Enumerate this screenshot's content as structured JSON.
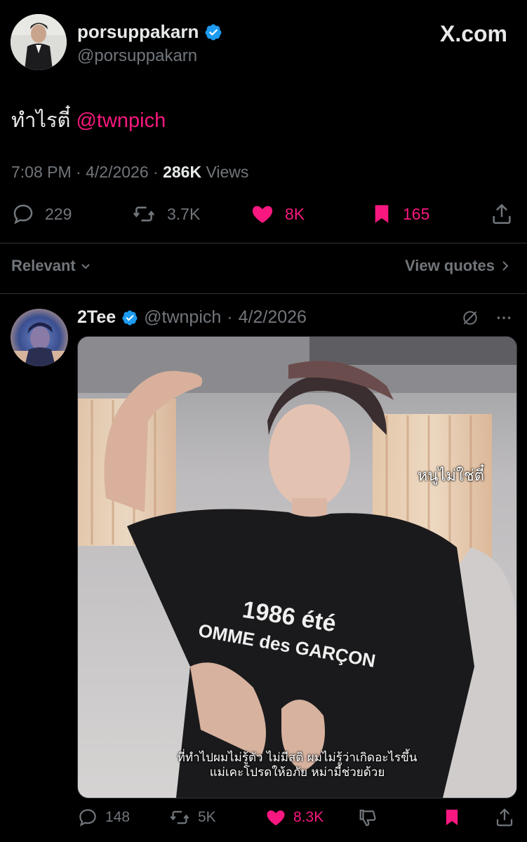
{
  "tweet": {
    "display_name": "porsuppakarn",
    "handle": "@porsuppakarn",
    "brand": "X.com",
    "text": "ทำไรตี๋",
    "mention": "@twnpich",
    "time": "7:08 PM",
    "date": "4/2/2026",
    "views_count": "286K",
    "views_label": "Views",
    "replies": "229",
    "reposts": "3.7K",
    "likes": "8K",
    "bookmarks": "165"
  },
  "sort": {
    "label": "Relevant",
    "view_quotes": "View quotes"
  },
  "reply": {
    "display_name": "2Tee",
    "handle": "@twnpich",
    "date": "4/2/2026",
    "media_caption_top": "หนูไม่ใช่ตี๋",
    "media_caption_line1": "ที่ทำไปผมไม่รู้ตัว ไม่มีสติ ผมไม่รู้ว่าเกิดอะไรขึ้น",
    "media_caption_line2": "แม่เคะโปรดให้อภัย หม่ามี้ช่วยด้วย",
    "shirt_line1": "1986 été",
    "shirt_line2": "OMME des GARÇON",
    "replies": "148",
    "reposts": "5K",
    "likes": "8.3K"
  },
  "colors": {
    "accent_pink": "#f9187f",
    "muted": "#71767b",
    "verified_blue": "#1d9bf0"
  },
  "icons": [
    "verified-badge-icon",
    "x-logo-icon",
    "reply-icon",
    "repost-icon",
    "heart-icon",
    "bookmark-icon",
    "share-icon",
    "chevron-down-icon",
    "chevron-right-icon",
    "grok-icon",
    "more-icon",
    "dislike-icon"
  ]
}
